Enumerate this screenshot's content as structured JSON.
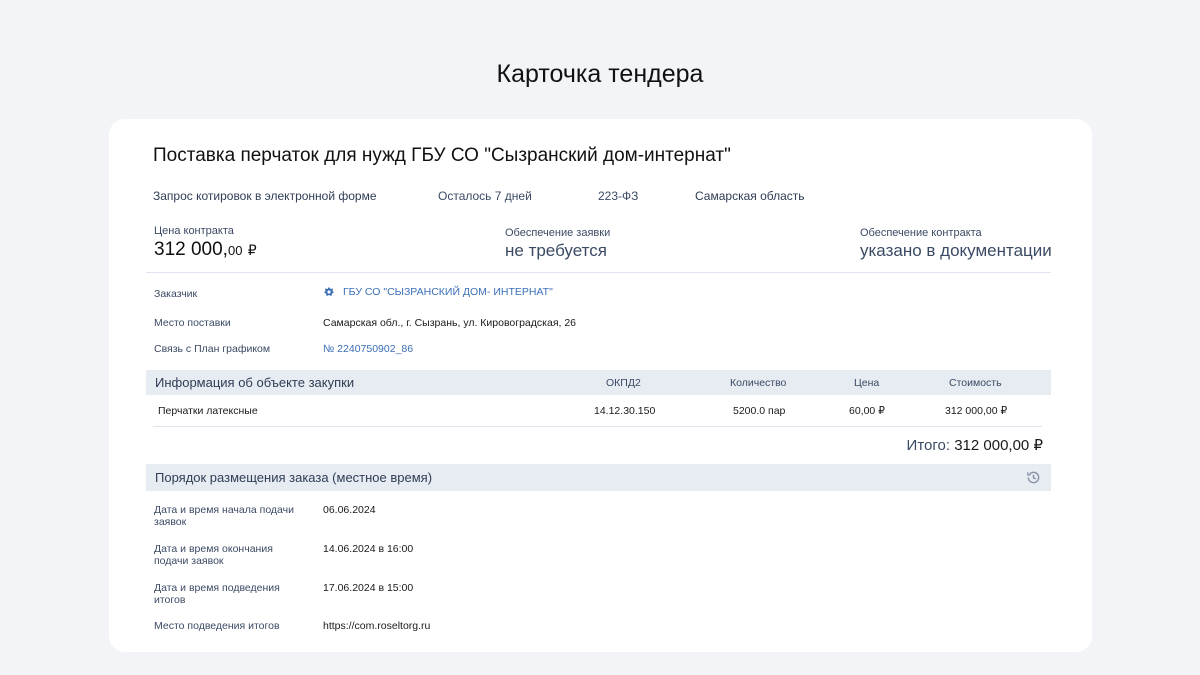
{
  "page": {
    "heading": "Карточка тендера"
  },
  "tender": {
    "title": "Поставка перчаток для нужд ГБУ СО \"Сызранский дом-интернат\"",
    "procedure": "Запрос котировок в электронной форме",
    "time_left": "Осталось 7 дней",
    "law": "223-ФЗ",
    "region": "Самарская область"
  },
  "prices": {
    "contract_price_label": "Цена контракта",
    "contract_price_main": "312 000,",
    "contract_price_cents": "00",
    "currency": "₽",
    "bid_security_label": "Обеспечение заявки",
    "bid_security_value": "не требуется",
    "contract_security_label": "Обеспечение контракта",
    "contract_security_value": "указано в документации"
  },
  "info": {
    "customer_label": "Заказчик",
    "customer_value": "ГБУ СО \"СЫЗРАНСКИЙ ДОМ- ИНТЕРНАТ\"",
    "delivery_label": "Место поставки",
    "delivery_value": "Самарская обл., г. Сызрань, ул. Кировоградская, 26",
    "plan_label": "Связь с План графиком",
    "plan_value": "№ 2240750902_86"
  },
  "items": {
    "section_title": "Информация об объекте закупки",
    "columns": {
      "okpd": "ОКПД2",
      "qty": "Количество",
      "price": "Цена",
      "cost": "Стоимость"
    },
    "rows": [
      {
        "name": "Перчатки латексные",
        "okpd": "14.12.30.150",
        "qty": "5200.0 пар",
        "price": "60,00 ₽",
        "cost": "312 000,00 ₽"
      }
    ],
    "total_label": "Итого:",
    "total_value": "312 000,00 ₽"
  },
  "order": {
    "section_title": "Порядок размещения заказа (местное время)",
    "start_label": "Дата и время начала подачи заявок",
    "start_value": "06.06.2024",
    "end_label": "Дата и время окончания подачи заявок",
    "end_value": "14.06.2024 в 16:00",
    "results_label": "Дата и время подведения итогов",
    "results_value": "17.06.2024 в 15:00",
    "place_label": "Место подведения итогов",
    "place_value": "https://com.roseltorg.ru"
  },
  "colors": {
    "background": "#f2f4f8",
    "card": "#ffffff",
    "section_bar": "#e7ebf2",
    "link": "#3a6fb6",
    "label": "#3b4a64"
  },
  "icons": {
    "customer": "emblem-icon",
    "history": "history-icon"
  }
}
